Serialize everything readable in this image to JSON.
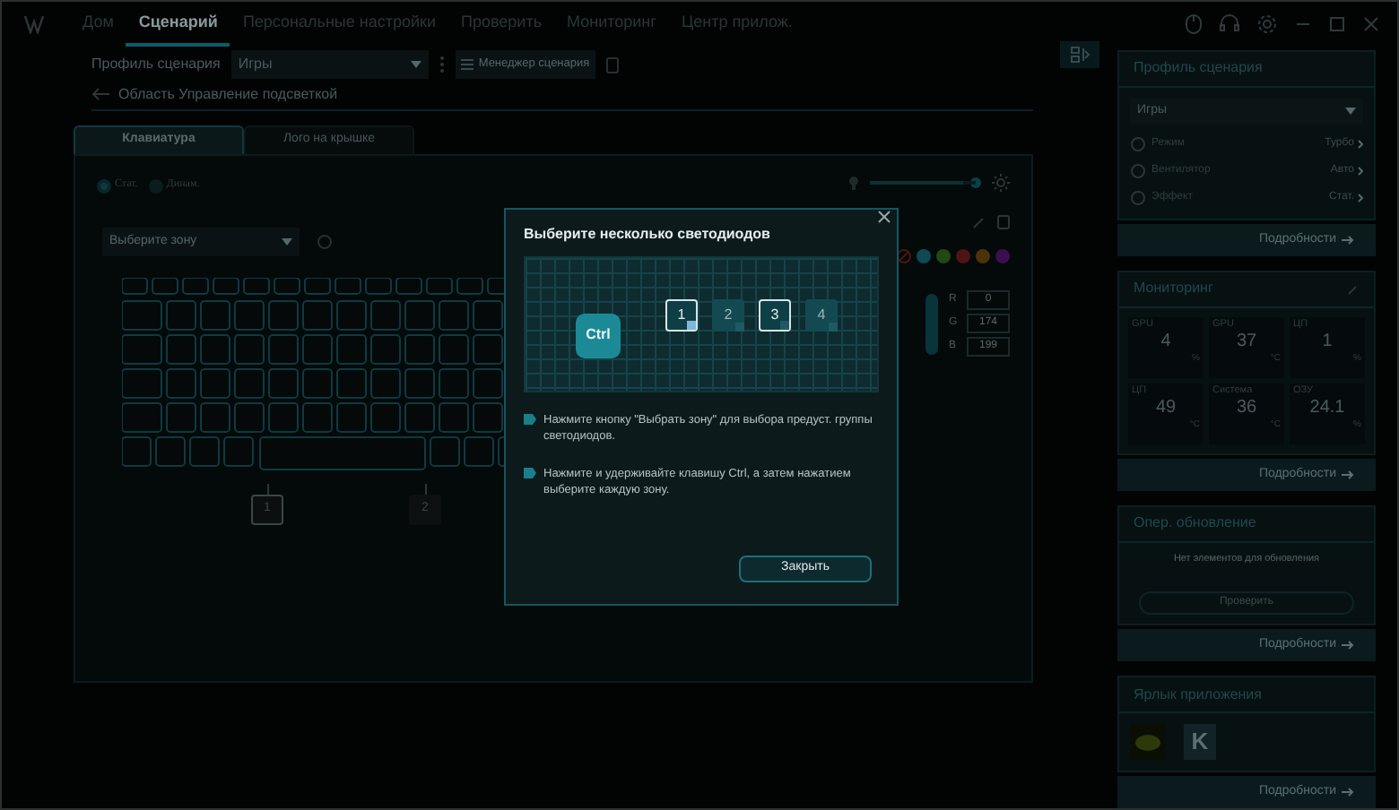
{
  "nav": {
    "tabs": [
      {
        "label": "Дом",
        "selected": false
      },
      {
        "label": "Сценарий",
        "selected": true
      },
      {
        "label": "Персональные настройки",
        "selected": false
      },
      {
        "label": "Проверить",
        "selected": false
      },
      {
        "label": "Мониторинг",
        "selected": false
      },
      {
        "label": "Центр прилож.",
        "selected": false
      }
    ]
  },
  "profile_bar": {
    "label": "Профиль сценария",
    "value": "Игры",
    "manager_button": "Менеджер сценария"
  },
  "breadcrumb": "Область Управление подсветкой",
  "subtabs": [
    {
      "label": "Клавиатура",
      "selected": true
    },
    {
      "label": "Лого на крышке",
      "selected": false
    }
  ],
  "modes": [
    {
      "label": "Стат.",
      "selected": true
    },
    {
      "label": "Динам.",
      "selected": false
    }
  ],
  "zone_select": {
    "placeholder": "Выберите зону"
  },
  "brightness": {
    "level": 0.88
  },
  "zones": [
    {
      "label": "1",
      "selected": true
    },
    {
      "label": "2",
      "selected": false
    }
  ],
  "swatches": [
    {
      "color": "#0e4a54"
    },
    {
      "color": "#1f4a14"
    },
    {
      "color": "#4d1414"
    },
    {
      "color": "#4d3208"
    },
    {
      "color": "#3a0f4d"
    }
  ],
  "rgb": [
    {
      "label": "R",
      "value": "0"
    },
    {
      "label": "G",
      "value": "174"
    },
    {
      "label": "B",
      "value": "199"
    }
  ],
  "side": {
    "expanded": true,
    "profile": {
      "title": "Профиль сценария",
      "value": "Игры",
      "rows": [
        {
          "label": "Режим",
          "value": "Турбо"
        },
        {
          "label": "Вентилятор",
          "value": "Авто"
        },
        {
          "label": "Эффект",
          "value": "Стат."
        }
      ],
      "details": "Подробности"
    },
    "monitoring": {
      "title": "Мониторинг",
      "tiles": [
        {
          "label": "GPU",
          "value": "4",
          "unit": "%"
        },
        {
          "label": "GPU",
          "value": "37",
          "unit": "°C"
        },
        {
          "label": "ЦП",
          "value": "1",
          "unit": "%"
        },
        {
          "label": "ЦП",
          "value": "49",
          "unit": "°C"
        },
        {
          "label": "Система",
          "value": "36",
          "unit": "°C"
        },
        {
          "label": "ОЗУ",
          "value": "24.1",
          "unit": "%"
        }
      ],
      "details": "Подробности"
    },
    "update": {
      "title": "Опер. обновление",
      "message": "Нет элементов для обновления",
      "button": "Проверить",
      "details": "Подробности"
    },
    "shortcuts": {
      "title": "Ярлык приложения",
      "apps": [
        {
          "kind": "chip"
        },
        {
          "kind": "letter",
          "label": "K"
        }
      ],
      "details": "Подробности"
    }
  },
  "dialog": {
    "title": "Выберите несколько светодиодов",
    "key": "Ctrl",
    "keys": [
      {
        "label": "1",
        "selected": true,
        "checked": true
      },
      {
        "label": "2",
        "selected": false,
        "checked": false
      },
      {
        "label": "3",
        "selected": true,
        "checked": false
      },
      {
        "label": "4",
        "selected": false,
        "checked": false
      }
    ],
    "tips": [
      "Нажмите кнопку \"Выбрать зону\" для выбора предуст. группы светодиодов.",
      "Нажмите и удерживайте клавишу Ctrl, а затем нажатием выберите каждую зону."
    ],
    "close_button": "Закрыть"
  }
}
